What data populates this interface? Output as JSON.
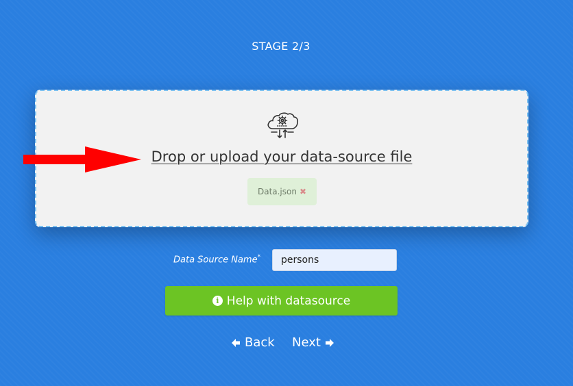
{
  "stage": {
    "title": "STAGE 2/3"
  },
  "dropzone": {
    "icon": "cloud-gear-upload-icon",
    "prompt": "Drop or upload your data-source file",
    "file_chip": {
      "name": "Data.json",
      "remove_glyph": "✖"
    }
  },
  "annotation": {
    "arrow_color": "#ff0000"
  },
  "form": {
    "label": "Data Source Name",
    "required_mark": "*",
    "value": "persons"
  },
  "help_button": {
    "label": "Help with datasource",
    "icon": "info-circle-icon"
  },
  "nav": {
    "back_label": "Back",
    "next_label": "Next",
    "back_icon": "arrow-left-icon",
    "next_icon": "arrow-right-icon"
  },
  "colors": {
    "background": "#2a7fe0",
    "dropzone_bg": "#f2f2f2",
    "dropzone_border": "#7cc1f0",
    "chip_bg": "#dff0d8",
    "button_green": "#6cc424"
  }
}
